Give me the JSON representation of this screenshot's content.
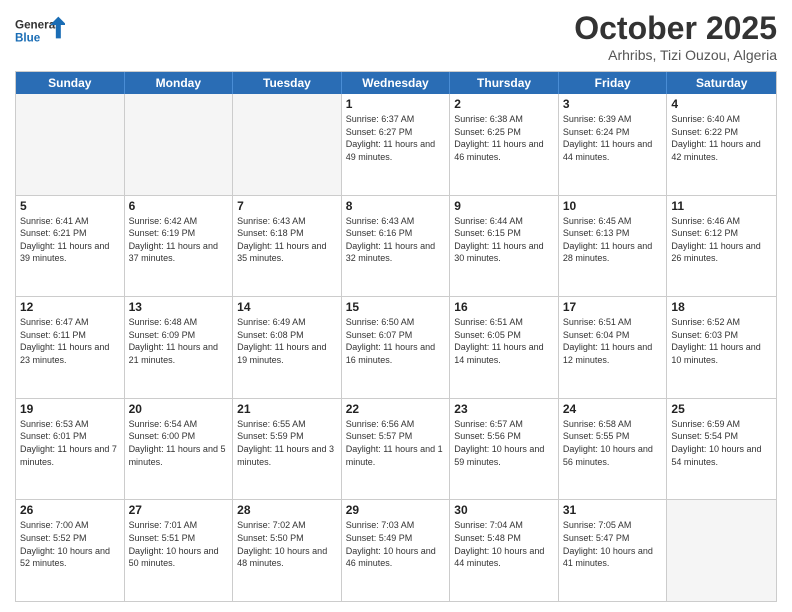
{
  "logo": {
    "line1": "General",
    "line2": "Blue"
  },
  "title": "October 2025",
  "subtitle": "Arhribs, Tizi Ouzou, Algeria",
  "weekdays": [
    "Sunday",
    "Monday",
    "Tuesday",
    "Wednesday",
    "Thursday",
    "Friday",
    "Saturday"
  ],
  "weeks": [
    [
      {
        "day": "",
        "info": ""
      },
      {
        "day": "",
        "info": ""
      },
      {
        "day": "",
        "info": ""
      },
      {
        "day": "1",
        "info": "Sunrise: 6:37 AM\nSunset: 6:27 PM\nDaylight: 11 hours and 49 minutes."
      },
      {
        "day": "2",
        "info": "Sunrise: 6:38 AM\nSunset: 6:25 PM\nDaylight: 11 hours and 46 minutes."
      },
      {
        "day": "3",
        "info": "Sunrise: 6:39 AM\nSunset: 6:24 PM\nDaylight: 11 hours and 44 minutes."
      },
      {
        "day": "4",
        "info": "Sunrise: 6:40 AM\nSunset: 6:22 PM\nDaylight: 11 hours and 42 minutes."
      }
    ],
    [
      {
        "day": "5",
        "info": "Sunrise: 6:41 AM\nSunset: 6:21 PM\nDaylight: 11 hours and 39 minutes."
      },
      {
        "day": "6",
        "info": "Sunrise: 6:42 AM\nSunset: 6:19 PM\nDaylight: 11 hours and 37 minutes."
      },
      {
        "day": "7",
        "info": "Sunrise: 6:43 AM\nSunset: 6:18 PM\nDaylight: 11 hours and 35 minutes."
      },
      {
        "day": "8",
        "info": "Sunrise: 6:43 AM\nSunset: 6:16 PM\nDaylight: 11 hours and 32 minutes."
      },
      {
        "day": "9",
        "info": "Sunrise: 6:44 AM\nSunset: 6:15 PM\nDaylight: 11 hours and 30 minutes."
      },
      {
        "day": "10",
        "info": "Sunrise: 6:45 AM\nSunset: 6:13 PM\nDaylight: 11 hours and 28 minutes."
      },
      {
        "day": "11",
        "info": "Sunrise: 6:46 AM\nSunset: 6:12 PM\nDaylight: 11 hours and 26 minutes."
      }
    ],
    [
      {
        "day": "12",
        "info": "Sunrise: 6:47 AM\nSunset: 6:11 PM\nDaylight: 11 hours and 23 minutes."
      },
      {
        "day": "13",
        "info": "Sunrise: 6:48 AM\nSunset: 6:09 PM\nDaylight: 11 hours and 21 minutes."
      },
      {
        "day": "14",
        "info": "Sunrise: 6:49 AM\nSunset: 6:08 PM\nDaylight: 11 hours and 19 minutes."
      },
      {
        "day": "15",
        "info": "Sunrise: 6:50 AM\nSunset: 6:07 PM\nDaylight: 11 hours and 16 minutes."
      },
      {
        "day": "16",
        "info": "Sunrise: 6:51 AM\nSunset: 6:05 PM\nDaylight: 11 hours and 14 minutes."
      },
      {
        "day": "17",
        "info": "Sunrise: 6:51 AM\nSunset: 6:04 PM\nDaylight: 11 hours and 12 minutes."
      },
      {
        "day": "18",
        "info": "Sunrise: 6:52 AM\nSunset: 6:03 PM\nDaylight: 11 hours and 10 minutes."
      }
    ],
    [
      {
        "day": "19",
        "info": "Sunrise: 6:53 AM\nSunset: 6:01 PM\nDaylight: 11 hours and 7 minutes."
      },
      {
        "day": "20",
        "info": "Sunrise: 6:54 AM\nSunset: 6:00 PM\nDaylight: 11 hours and 5 minutes."
      },
      {
        "day": "21",
        "info": "Sunrise: 6:55 AM\nSunset: 5:59 PM\nDaylight: 11 hours and 3 minutes."
      },
      {
        "day": "22",
        "info": "Sunrise: 6:56 AM\nSunset: 5:57 PM\nDaylight: 11 hours and 1 minute."
      },
      {
        "day": "23",
        "info": "Sunrise: 6:57 AM\nSunset: 5:56 PM\nDaylight: 10 hours and 59 minutes."
      },
      {
        "day": "24",
        "info": "Sunrise: 6:58 AM\nSunset: 5:55 PM\nDaylight: 10 hours and 56 minutes."
      },
      {
        "day": "25",
        "info": "Sunrise: 6:59 AM\nSunset: 5:54 PM\nDaylight: 10 hours and 54 minutes."
      }
    ],
    [
      {
        "day": "26",
        "info": "Sunrise: 7:00 AM\nSunset: 5:52 PM\nDaylight: 10 hours and 52 minutes."
      },
      {
        "day": "27",
        "info": "Sunrise: 7:01 AM\nSunset: 5:51 PM\nDaylight: 10 hours and 50 minutes."
      },
      {
        "day": "28",
        "info": "Sunrise: 7:02 AM\nSunset: 5:50 PM\nDaylight: 10 hours and 48 minutes."
      },
      {
        "day": "29",
        "info": "Sunrise: 7:03 AM\nSunset: 5:49 PM\nDaylight: 10 hours and 46 minutes."
      },
      {
        "day": "30",
        "info": "Sunrise: 7:04 AM\nSunset: 5:48 PM\nDaylight: 10 hours and 44 minutes."
      },
      {
        "day": "31",
        "info": "Sunrise: 7:05 AM\nSunset: 5:47 PM\nDaylight: 10 hours and 41 minutes."
      },
      {
        "day": "",
        "info": ""
      }
    ]
  ]
}
